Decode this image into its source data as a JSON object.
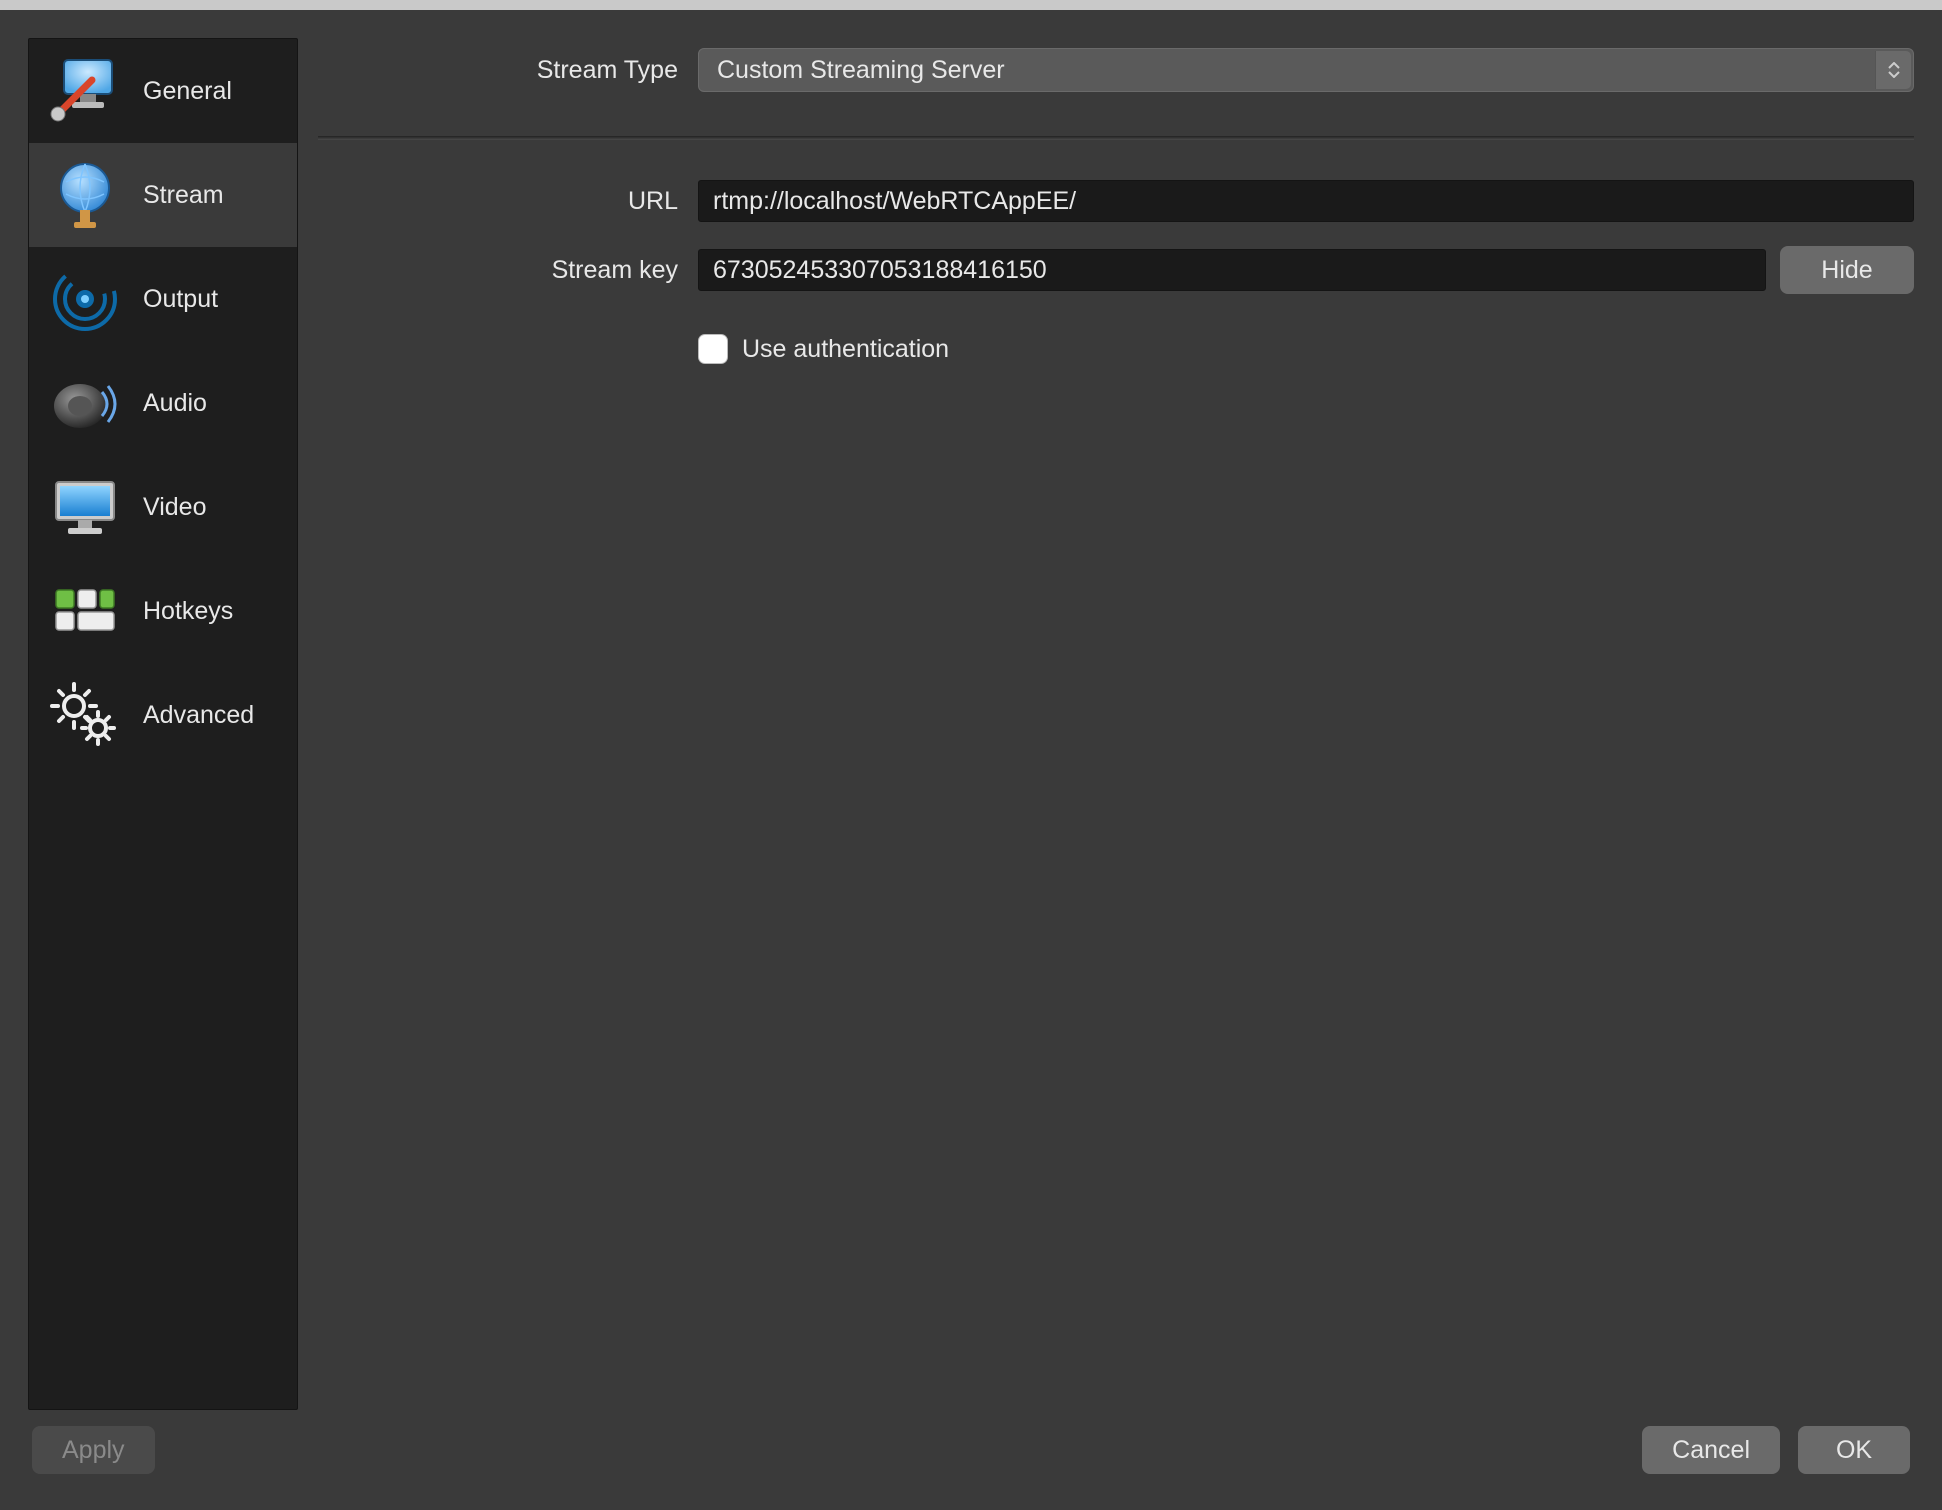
{
  "sidebar": {
    "items": [
      {
        "label": "General"
      },
      {
        "label": "Stream"
      },
      {
        "label": "Output"
      },
      {
        "label": "Audio"
      },
      {
        "label": "Video"
      },
      {
        "label": "Hotkeys"
      },
      {
        "label": "Advanced"
      }
    ],
    "selected_index": 1
  },
  "form": {
    "stream_type": {
      "label": "Stream Type",
      "value": "Custom Streaming Server"
    },
    "url": {
      "label": "URL",
      "value": "rtmp://localhost/WebRTCAppEE/"
    },
    "stream_key": {
      "label": "Stream key",
      "value": "673052453307053188416150",
      "hide_btn": "Hide"
    },
    "use_auth": {
      "label": "Use authentication",
      "checked": false
    }
  },
  "footer": {
    "apply": "Apply",
    "cancel": "Cancel",
    "ok": "OK"
  },
  "colors": {
    "bg": "#3a3a3a",
    "sidebar_bg": "#1e1e1e",
    "input_bg": "#1a1a1a",
    "button_bg": "#6a6a6a"
  }
}
